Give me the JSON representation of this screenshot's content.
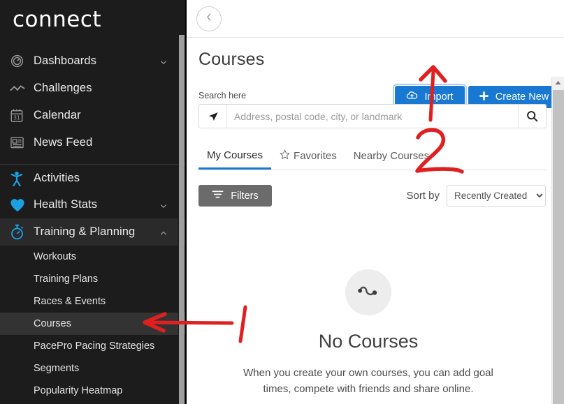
{
  "sidebar": {
    "brand": "connect",
    "items": [
      {
        "label": "Dashboards",
        "icon": "gauge-icon",
        "chevron": "chevron-down-icon",
        "expanded": false
      },
      {
        "label": "Challenges",
        "icon": "zigzag-line-icon",
        "chevron": "",
        "expanded": false
      },
      {
        "label": "Calendar",
        "icon": "calendar-icon",
        "chevron": "",
        "expanded": false
      },
      {
        "label": "News Feed",
        "icon": "news-feed-icon",
        "chevron": "",
        "expanded": false
      },
      {
        "label": "Activities",
        "icon": "person-icon",
        "chevron": "",
        "expanded": false
      },
      {
        "label": "Health Stats",
        "icon": "heart-icon",
        "chevron": "chevron-down-icon",
        "expanded": false
      },
      {
        "label": "Training & Planning",
        "icon": "stopwatch-icon",
        "chevron": "chevron-up-icon",
        "expanded": true
      }
    ],
    "subitems": [
      {
        "label": "Workouts",
        "active": false
      },
      {
        "label": "Training Plans",
        "active": false
      },
      {
        "label": "Races & Events",
        "active": false
      },
      {
        "label": "Courses",
        "active": true
      },
      {
        "label": "PacePro Pacing Strategies",
        "active": false
      },
      {
        "label": "Segments",
        "active": false
      },
      {
        "label": "Popularity Heatmap",
        "active": false
      }
    ],
    "calendar_day": "31"
  },
  "topbar": {
    "back_icon": "chevron-left-icon"
  },
  "page": {
    "title": "Courses",
    "import_label": "Import",
    "import_icon": "cloud-upload-icon",
    "create_label": "Create New",
    "create_icon": "plus-icon"
  },
  "search": {
    "label": "Search here",
    "placeholder": "Address, postal code, city, or landmark",
    "value": "",
    "geo_icon": "location-arrow-icon",
    "search_icon": "search-icon"
  },
  "tabs": [
    {
      "label": "My Courses",
      "icon": "",
      "active": true
    },
    {
      "label": "Favorites",
      "icon": "star-outline-icon",
      "active": false
    },
    {
      "label": "Nearby Courses",
      "icon": "",
      "active": false
    }
  ],
  "controls": {
    "filters_label": "Filters",
    "filters_icon": "filter-icon",
    "sort_by_label": "Sort by",
    "sort_selected": "Recently Created",
    "sort_options": [
      "Recently Created"
    ],
    "sort_chevron": "chevron-down-icon"
  },
  "empty_state": {
    "icon": "course-route-icon",
    "title": "No Courses",
    "description": "When you create your own courses, you can add goal times, compete with friends and share online."
  },
  "annotations": {
    "color": "#e02020",
    "marks": [
      {
        "type": "arrow-left",
        "label": "1",
        "target": "sidebar-item-courses"
      },
      {
        "type": "arrow-up",
        "label": "2",
        "target": "import-button"
      }
    ],
    "label_one": "1",
    "label_two": "2"
  },
  "colors": {
    "accent_blue": "#1878d2",
    "sidebar_bg": "#1c1c1c",
    "icon_blue": "#1ba0e2",
    "filters_gray": "#6b6b6b",
    "annotation_red": "#e02020"
  }
}
